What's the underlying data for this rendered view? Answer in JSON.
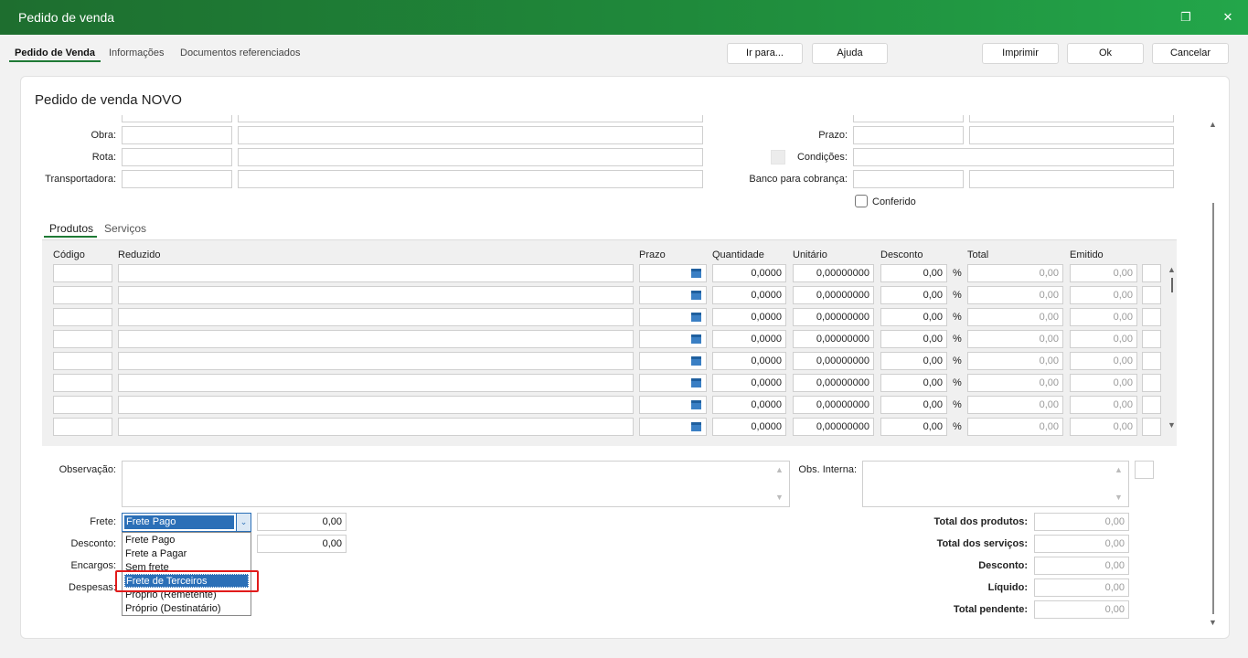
{
  "window": {
    "title": "Pedido de venda",
    "restore_icon": "restore-icon",
    "close_icon": "close-icon"
  },
  "tabs": [
    "Pedido de Venda",
    "Informações",
    "Documentos referenciados"
  ],
  "buttons": {
    "ir_para": "Ir para...",
    "ajuda": "Ajuda",
    "imprimir": "Imprimir",
    "ok": "Ok",
    "cancelar": "Cancelar"
  },
  "form": {
    "title": "Pedido de venda NOVO",
    "obra": "Obra:",
    "rota": "Rota:",
    "transportadora": "Transportadora:",
    "prazo": "Prazo:",
    "condicoes": "Condições:",
    "banco": "Banco para cobrança:",
    "conferido": "Conferido"
  },
  "subtabs": [
    "Produtos",
    "Serviços"
  ],
  "grid": {
    "headers": [
      "Código",
      "Reduzido",
      "Prazo",
      "Quantidade",
      "Unitário",
      "Desconto",
      "Total",
      "Emitido"
    ],
    "row": {
      "quantidade": "0,0000",
      "unitario": "0,00000000",
      "desconto": "0,00",
      "pct": "%",
      "total": "0,00",
      "emitido": "0,00"
    }
  },
  "footer": {
    "observacao": "Observação:",
    "obs_interna": "Obs. Interna:",
    "frete": "Frete:",
    "desconto": "Desconto:",
    "encargos": "Encargos:",
    "despesas": "Despesas:",
    "frete_valor": "0,00",
    "desconto_valor": "0,00",
    "frete_selected": "Frete Pago",
    "frete_options": [
      "Frete Pago",
      "Frete a Pagar",
      "Sem frete",
      "Frete de Terceiros",
      "Próprio (Remetente)",
      "Próprio (Destinatário)"
    ],
    "totals": {
      "produtos_label": "Total dos produtos:",
      "produtos": "0,00",
      "servicos_label": "Total dos serviços:",
      "servicos": "0,00",
      "desconto_label": "Desconto:",
      "desconto": "0,00",
      "liquido_label": "Líquido:",
      "liquido": "0,00",
      "pendente_label": "Total pendente:",
      "pendente": "0,00"
    }
  }
}
